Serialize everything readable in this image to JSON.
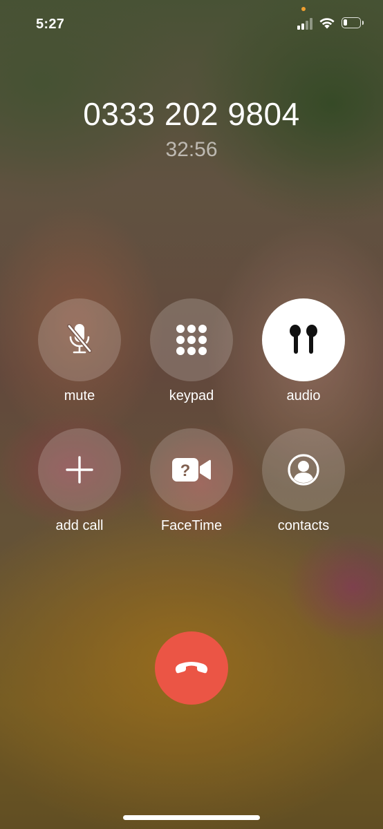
{
  "status_bar": {
    "time": "5:27",
    "icons": [
      "privacy-indicator-dot",
      "cellular-signal-icon",
      "wifi-icon",
      "battery-icon"
    ],
    "battery_level": 0.25,
    "signal_bars": 2
  },
  "call": {
    "number": "0333 202 9804",
    "duration": "32:56"
  },
  "controls": {
    "mute": {
      "label": "mute",
      "icon": "microphone-slash-icon"
    },
    "keypad": {
      "label": "keypad",
      "icon": "keypad-grid-icon"
    },
    "audio": {
      "label": "audio",
      "icon": "airpods-icon",
      "active": true
    },
    "add_call": {
      "label": "add call",
      "icon": "plus-icon"
    },
    "facetime": {
      "label": "FaceTime",
      "icon": "video-camera-question-icon"
    },
    "contacts": {
      "label": "contacts",
      "icon": "person-circle-icon"
    }
  },
  "end_call": {
    "icon": "phone-hangup-icon"
  },
  "colors": {
    "end_call": "#eb5545",
    "active_button": "#ffffff",
    "indicator_dot": "#f0a030"
  }
}
